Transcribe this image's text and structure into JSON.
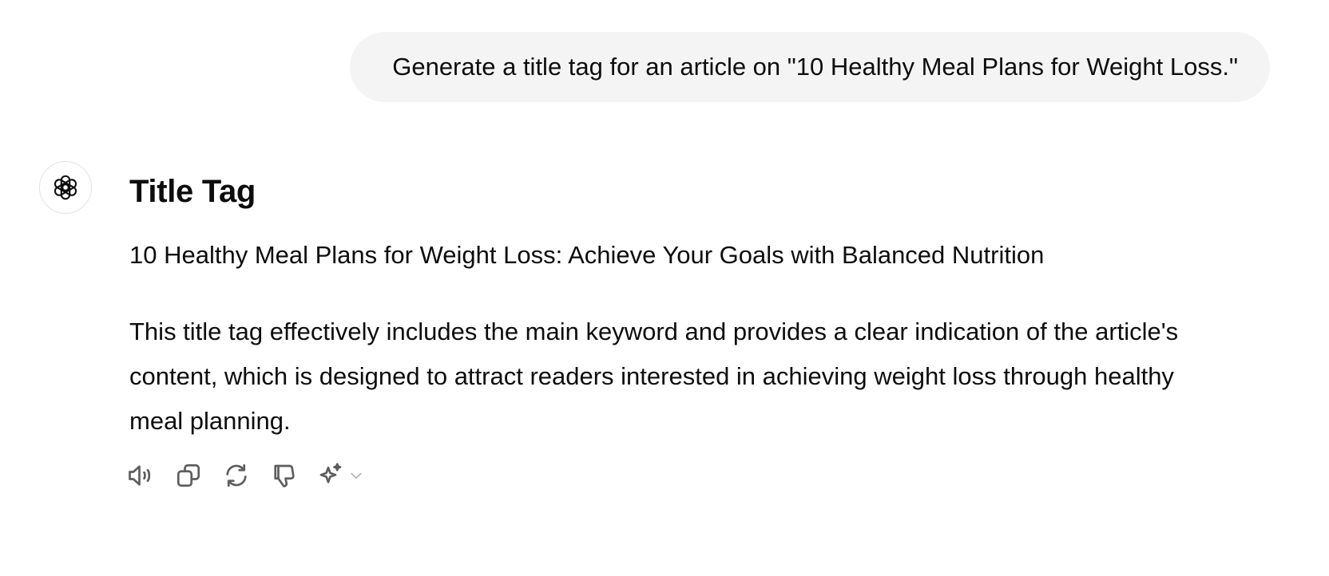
{
  "user_message": {
    "text": "Generate a title tag for an article on \"10 Healthy Meal Plans for Weight Loss.\""
  },
  "assistant": {
    "avatar_icon": "openai-logo-icon",
    "heading": "Title Tag",
    "title_tag": "10 Healthy Meal Plans for Weight Loss: Achieve Your Goals with Balanced Nutrition",
    "explanation": "This title tag effectively includes the main keyword and provides a clear indication of the article's content, which is designed to attract readers interested in achieving weight loss through healthy meal planning."
  },
  "actions": [
    {
      "name": "read-aloud",
      "icon": "speaker-icon"
    },
    {
      "name": "copy",
      "icon": "copy-icon"
    },
    {
      "name": "regenerate",
      "icon": "refresh-icon"
    },
    {
      "name": "bad-response",
      "icon": "thumbs-down-icon"
    },
    {
      "name": "change-model",
      "icon": "sparkle-icon"
    }
  ],
  "colors": {
    "bubble_bg": "#f4f4f4",
    "text": "#0d0d0d",
    "icon": "#5d5d5d"
  }
}
